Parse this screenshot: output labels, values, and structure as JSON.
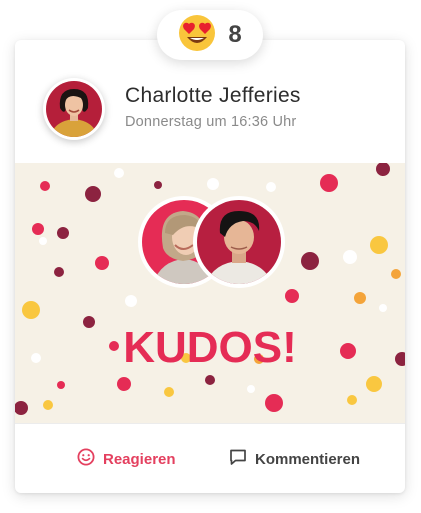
{
  "reaction": {
    "icon": "heart-eyes-emoji-icon",
    "count": "8"
  },
  "post": {
    "author": "Charlotte Jefferies",
    "timestamp": "Donnerstag um 16:36 Uhr",
    "banner_text": "KUDOS!"
  },
  "actions": {
    "react_label": "Reagieren",
    "comment_label": "Kommentieren"
  },
  "colors": {
    "accent": "#e4405f",
    "kudos_text": "#e52c55",
    "banner_bg": "#f6f1e6",
    "dot_maroon": "#8c2340",
    "dot_red": "#e52c55",
    "dot_yellow": "#f9c740",
    "dot_orange": "#f4a43a"
  }
}
